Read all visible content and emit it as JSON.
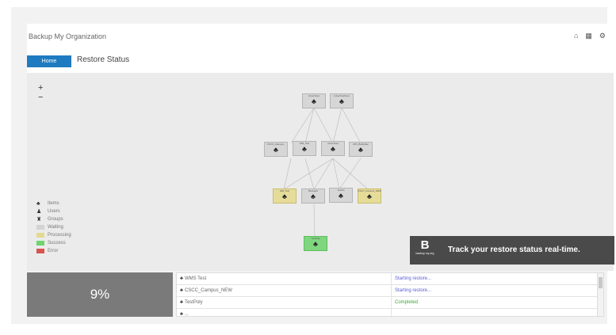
{
  "header": {
    "app_title": "Backup My Organization",
    "icons": [
      "home-icon",
      "grid-icon",
      "gear-icon"
    ]
  },
  "tabs": {
    "home_label": "Home",
    "page_title": "Restore Status"
  },
  "zoom": {
    "in_label": "+",
    "out_label": "−"
  },
  "graph": {
    "nodes": [
      {
        "label": "(UserTest)",
        "status": "waiting"
      },
      {
        "label": "(UserTestTest)",
        "status": "waiting"
      },
      {
        "label": "CSCC_Campus_",
        "status": "waiting"
      },
      {
        "label": "WM_Test",
        "status": "waiting"
      },
      {
        "label": "(UserTest)",
        "status": "waiting"
      },
      {
        "label": "ATD_BulkyRec",
        "status": "waiting"
      },
      {
        "label": "WM_Test",
        "status": "processing"
      },
      {
        "label": "BackupIt",
        "status": "waiting"
      },
      {
        "label": "TestUs",
        "status": "waiting"
      },
      {
        "label": "CSCC_Campus_NEW",
        "status": "processing"
      },
      {
        "label": "TestPoly",
        "status": "success"
      }
    ],
    "node_icon": "items-icon"
  },
  "legend": {
    "types": [
      {
        "icon": "items-icon",
        "label": "Items"
      },
      {
        "icon": "user-icon",
        "label": "Users"
      },
      {
        "icon": "group-icon",
        "label": "Groups"
      }
    ],
    "statuses": [
      {
        "label": "Waiting",
        "color": "#d3d3d3"
      },
      {
        "label": "Processing",
        "color": "#e3d98f"
      },
      {
        "label": "Success",
        "color": "#6fd46f"
      },
      {
        "label": "Error",
        "color": "#d9534f"
      }
    ]
  },
  "banner": {
    "logo_letter": "B",
    "logo_sub": "backup my org",
    "text": "Track your restore status real-time."
  },
  "progress": {
    "percent_label": "9%",
    "percent": 9
  },
  "table": {
    "rows": [
      {
        "icon": "items-icon",
        "name": "WMS Test",
        "status": "Starting restore...",
        "status_color": "#5b5bd6"
      },
      {
        "icon": "items-icon",
        "name": "CSCC_Campus_NEW",
        "status": "Starting restore...",
        "status_color": "#5b5bd6"
      },
      {
        "icon": "items-icon",
        "name": "TestPoly",
        "status": "Completed",
        "status_color": "#3aa83a"
      },
      {
        "icon": "items-icon",
        "name": "...",
        "status": "",
        "status_color": "#666666"
      }
    ]
  }
}
